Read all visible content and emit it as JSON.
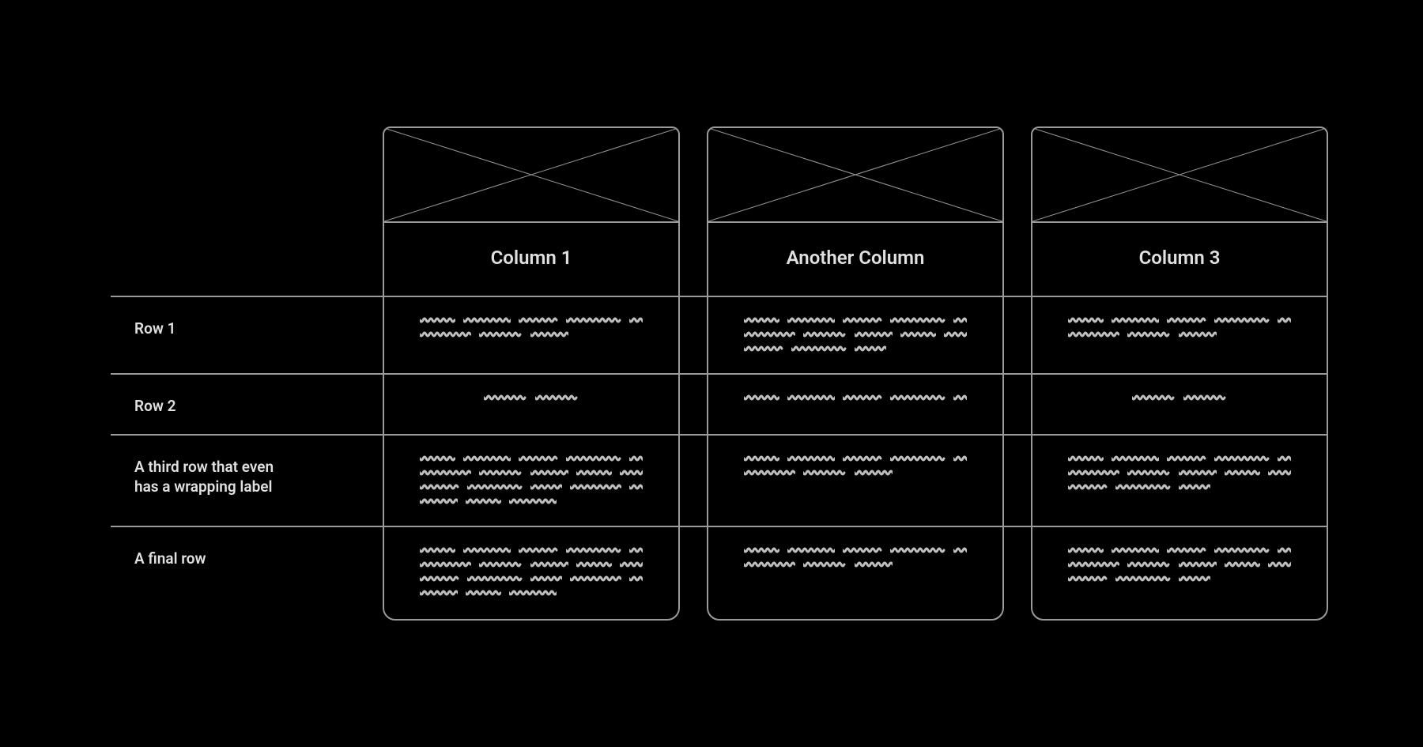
{
  "columns": [
    {
      "title": "Column 1"
    },
    {
      "title": "Another Column"
    },
    {
      "title": "Column 3"
    }
  ],
  "rows": [
    {
      "label": "Row 1",
      "cells": [
        {
          "lines": 2,
          "align": "left"
        },
        {
          "lines": 3,
          "align": "left"
        },
        {
          "lines": 2,
          "align": "left"
        }
      ]
    },
    {
      "label": "Row 2",
      "cells": [
        {
          "lines": 1,
          "align": "center",
          "short": true
        },
        {
          "lines": 1,
          "align": "left"
        },
        {
          "lines": 1,
          "align": "center",
          "short": true
        }
      ]
    },
    {
      "label": "A third row that even has a wrapping label",
      "cells": [
        {
          "lines": 4,
          "align": "left"
        },
        {
          "lines": 2,
          "align": "left"
        },
        {
          "lines": 3,
          "align": "left"
        }
      ]
    },
    {
      "label": "A final row",
      "cells": [
        {
          "lines": 4,
          "align": "left"
        },
        {
          "lines": 2,
          "align": "left"
        },
        {
          "lines": 3,
          "align": "left"
        }
      ]
    }
  ],
  "colors": {
    "border": "#9a9a9a",
    "squiggle": "#bfbfbf"
  }
}
